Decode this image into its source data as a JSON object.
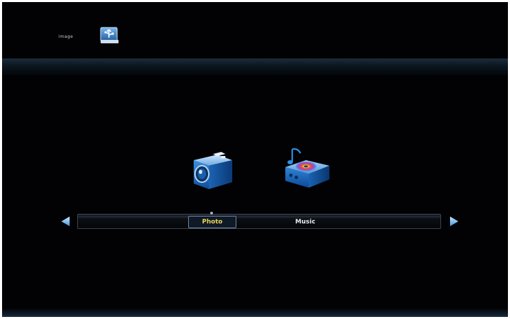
{
  "header": {
    "source_label": "image",
    "source_icon": "usb-drive-icon"
  },
  "media_icons": [
    {
      "name": "photo",
      "icon": "camera-icon"
    },
    {
      "name": "music",
      "icon": "music-box-icon"
    }
  ],
  "categories": {
    "items": [
      {
        "label": "Photo",
        "selected": true
      },
      {
        "label": "Music",
        "selected": false
      }
    ]
  },
  "navigation": {
    "left_icon": "arrow-left-icon",
    "right_icon": "arrow-right-icon"
  },
  "colors": {
    "background": "#020204",
    "selected_text": "#e8d35a",
    "text": "#e8ecf0",
    "accent": "#2a86d8"
  }
}
